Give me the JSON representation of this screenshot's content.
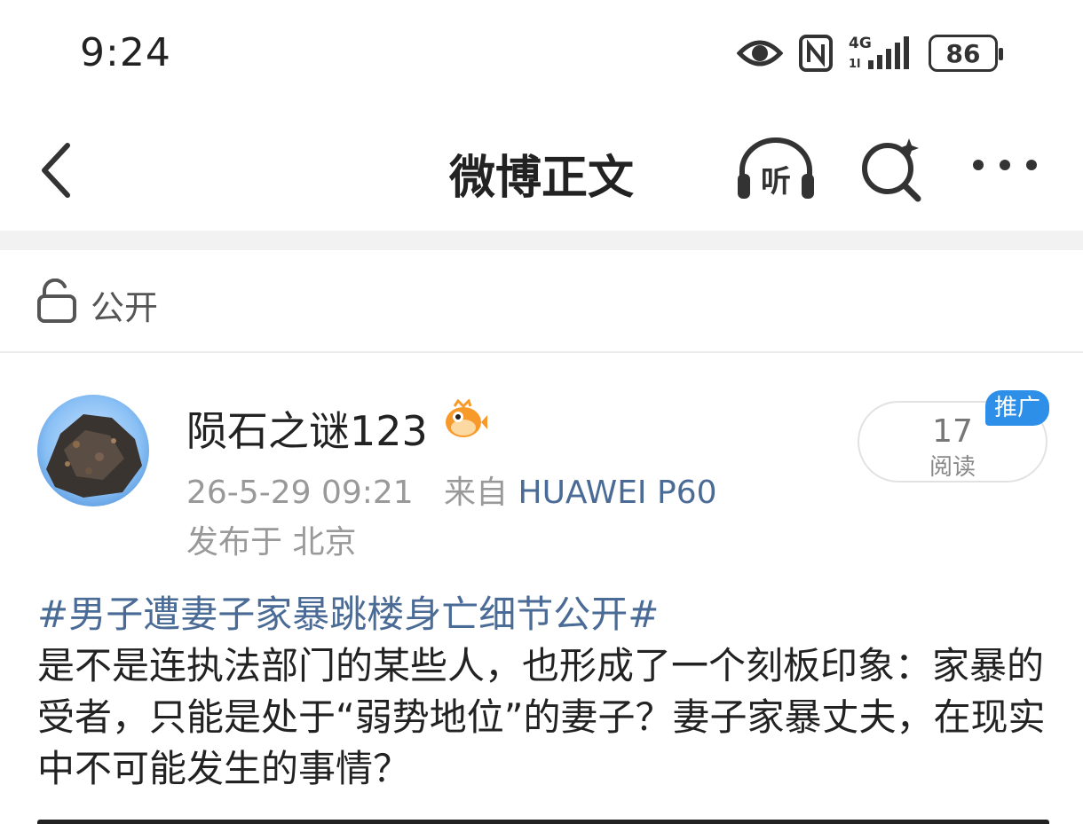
{
  "status_bar": {
    "time": "9:24",
    "network": "4G",
    "battery": "86"
  },
  "nav": {
    "title": "微博正文",
    "listen_label": "听"
  },
  "visibility": {
    "label": "公开"
  },
  "post": {
    "author": "陨石之谜123",
    "datetime": "26-5-29 09:21",
    "source_prefix": "来自",
    "device": "HUAWEI P60",
    "location": "发布于 北京",
    "read_count": "17",
    "read_label": "阅读",
    "promo_label": "推广",
    "hashtag": "#男子遭妻子家暴跳楼身亡细节公开#",
    "text": "是不是连执法部门的某些人，也形成了一个刻板印象：家暴的受者，只能是处于“弱势地位”的妻子？妻子家暴丈夫，在现实中不可能发生的事情？"
  },
  "colors": {
    "link": "#4a6b96",
    "promo": "#2d8fe8"
  },
  "icons": [
    "eye-icon",
    "nfc-icon",
    "signal-icon",
    "battery-icon",
    "back-icon",
    "headphones-icon",
    "search-sparkle-icon",
    "more-icon",
    "lock-icon",
    "fish-badge-icon"
  ]
}
